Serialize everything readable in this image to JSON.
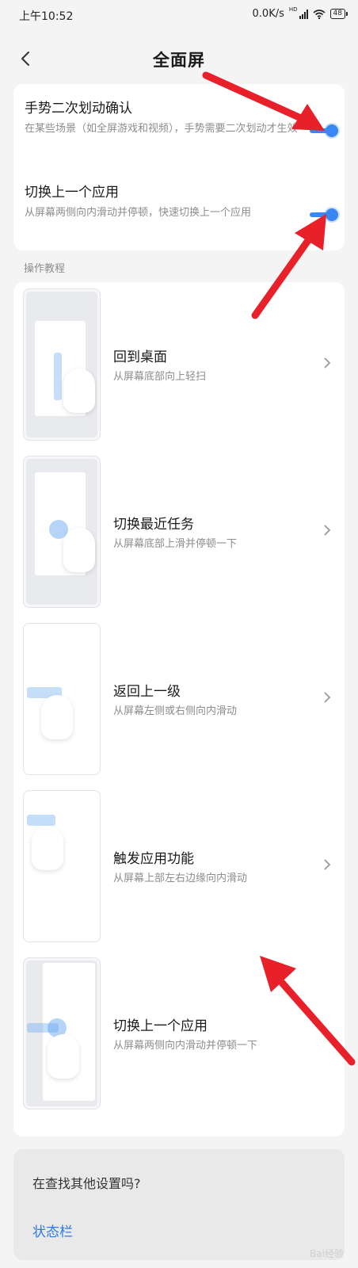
{
  "status_bar": {
    "time": "上午10:52",
    "net_speed": "0.0K/s",
    "network_badge": "HD",
    "battery": "48"
  },
  "header": {
    "title": "全面屏",
    "back_icon": "chevron-left-icon"
  },
  "toggles": [
    {
      "label": "手势二次划动确认",
      "description": "在某些场景（如全屏游戏和视频），手势需要二次划动才生效",
      "enabled": true
    },
    {
      "label": "切换上一个应用",
      "description": "从屏幕两侧向内滑动并停顿，快速切换上一个应用",
      "enabled": true
    }
  ],
  "section_label": "操作教程",
  "tutorials": [
    {
      "title": "回到桌面",
      "description": "从屏幕底部向上轻扫",
      "has_chevron": true
    },
    {
      "title": "切换最近任务",
      "description": "从屏幕底部上滑并停顿一下",
      "has_chevron": true
    },
    {
      "title": "返回上一级",
      "description": "从屏幕左侧或右侧向内滑动",
      "has_chevron": true
    },
    {
      "title": "触发应用功能",
      "description": "从屏幕上部左右边缘向内滑动",
      "has_chevron": true
    },
    {
      "title": "切换上一个应用",
      "description": "从屏幕两侧向内滑动并停顿一下",
      "has_chevron": false
    }
  ],
  "search_prompt": {
    "question": "在查找其他设置吗?",
    "link": "状态栏"
  },
  "watermark": "Bai经验",
  "colors": {
    "accent": "#3a86f2",
    "link": "#2f7ae5",
    "annotation_arrow": "#e8202a"
  }
}
